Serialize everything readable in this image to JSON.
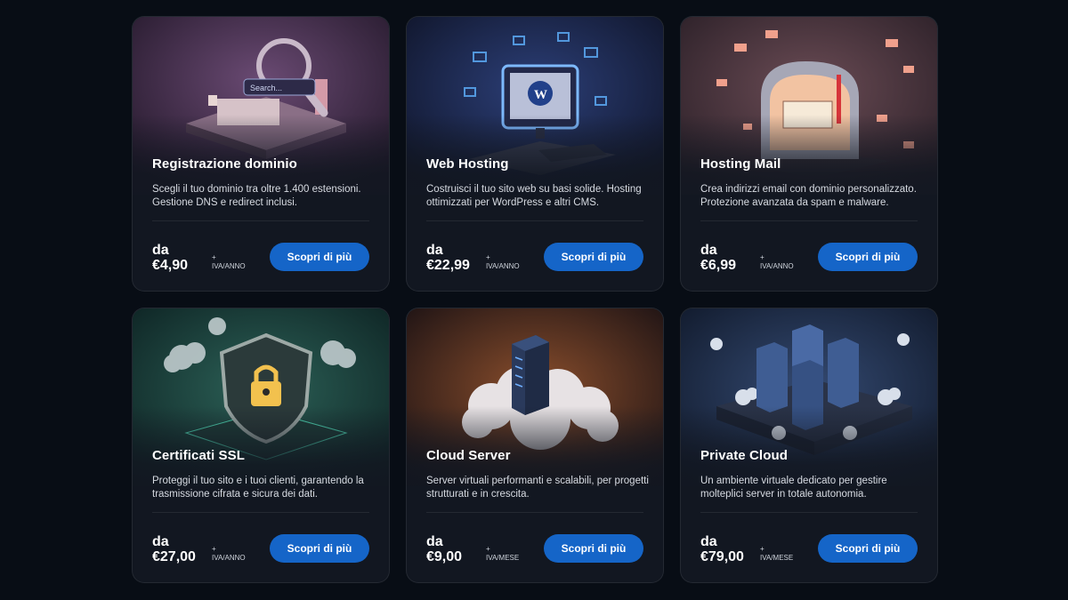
{
  "cards": [
    {
      "title": "Registrazione dominio",
      "description": "Scegli il tuo dominio tra oltre 1.400 estensioni. Gestione DNS e redirect inclusi.",
      "prefix": "da",
      "price": "€4,90",
      "tax_plus": "+",
      "tax": "IVA/ANNO",
      "button": "Scopri di più",
      "search_text": "Search...",
      "colors": {
        "bg1": "#3a2540",
        "bg2": "#5b3a63",
        "accent": "#d18fb6"
      }
    },
    {
      "title": "Web Hosting",
      "description": "Costruisci il tuo sito web su basi solide. Hosting ottimizzati per WordPress e altri CMS.",
      "prefix": "da",
      "price": "€22,99",
      "tax_plus": "+",
      "tax": "IVA/ANNO",
      "button": "Scopri di più",
      "colors": {
        "bg1": "#121a35",
        "bg2": "#22335e",
        "accent": "#4fa3ff"
      }
    },
    {
      "title": "Hosting Mail",
      "description": "Crea indirizzi email con dominio personalizzato. Protezione avanzata da spam e malware.",
      "prefix": "da",
      "price": "€6,99",
      "tax_plus": "+",
      "tax": "IVA/ANNO",
      "button": "Scopri di più",
      "colors": {
        "bg1": "#3b2a32",
        "bg2": "#5e3f44",
        "accent": "#f08a6b"
      }
    },
    {
      "title": "Certificati SSL",
      "description": "Proteggi il tuo sito e i tuoi clienti, garantendo la trasmissione cifrata e sicura dei dati.",
      "prefix": "da",
      "price": "€27,00",
      "tax_plus": "+",
      "tax": "IVA/ANNO",
      "button": "Scopri di più",
      "colors": {
        "bg1": "#10302e",
        "bg2": "#1d4a43",
        "accent": "#f2c14e"
      }
    },
    {
      "title": "Cloud Server",
      "description": "Server virtuali performanti e scalabili, per progetti strutturati e in crescita.",
      "prefix": "da",
      "price": "€9,00",
      "tax_plus": "+",
      "tax": "IVA/MESE",
      "button": "Scopri di più",
      "colors": {
        "bg1": "#2a1a14",
        "bg2": "#5a3522",
        "accent": "#f0a35a"
      }
    },
    {
      "title": "Private Cloud",
      "description": "Un ambiente virtuale dedicato per gestire molteplici server in totale autonomia.",
      "prefix": "da",
      "price": "€79,00",
      "tax_plus": "+",
      "tax": "IVA/MESE",
      "button": "Scopri di più",
      "colors": {
        "bg1": "#15213a",
        "bg2": "#263a5e",
        "accent": "#7fb6ff"
      }
    }
  ],
  "button_color": "#1565c8",
  "page_background": "#080d15"
}
